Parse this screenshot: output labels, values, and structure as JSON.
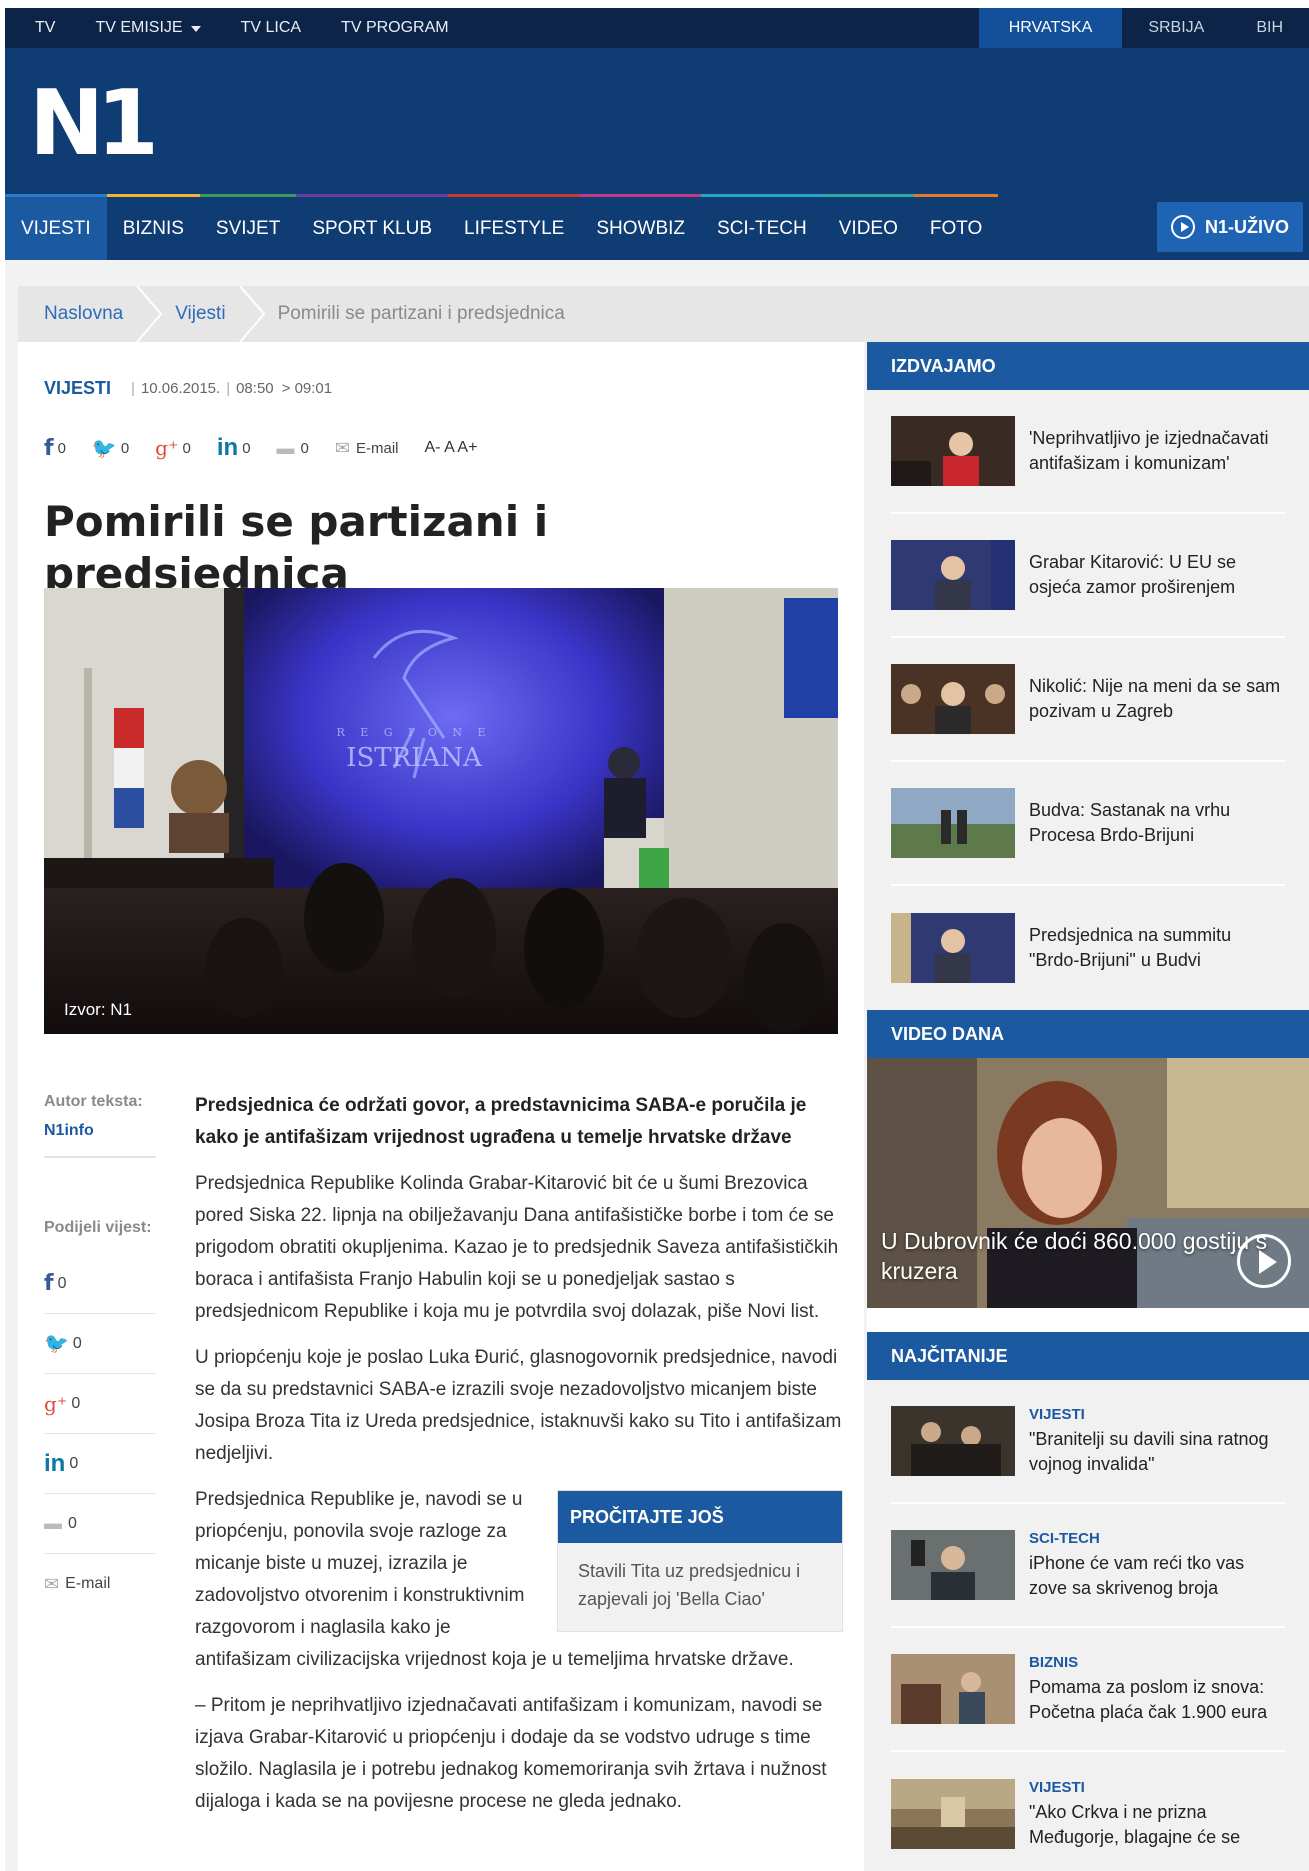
{
  "topbar": {
    "links": [
      "TV",
      "TV EMISIJE",
      "TV LICA",
      "TV PROGRAM"
    ],
    "regions": [
      "HRVATSKA",
      "SRBIJA",
      "BIH"
    ]
  },
  "logo": "N1",
  "nav": {
    "items": [
      "VIJESTI",
      "BIZNIS",
      "SVIJET",
      "SPORT KLUB",
      "LIFESTYLE",
      "SHOWBIZ",
      "SCI-TECH",
      "VIDEO",
      "FOTO"
    ],
    "live": "N1-UŽIVO"
  },
  "breadcrumb": [
    "Naslovna",
    "Vijesti",
    "Pomirili se partizani i predsjednica"
  ],
  "article": {
    "category": "VIJESTI",
    "date": "10.06.2015.",
    "time": "08:50",
    "updated": "> 09:01",
    "share_counts": {
      "facebook": "0",
      "twitter": "0",
      "gplus": "0",
      "linkedin": "0",
      "comments": "0"
    },
    "email_label": "E-mail",
    "font_controls": "A- A A+",
    "title": "Pomirili se partizani i predsjednica",
    "photo_caption": "Izvor: N1",
    "photo_signage": "R E G I O N E\nISTRIANA",
    "author_label": "Autor teksta:",
    "author": "N1info",
    "share_label": "Podijeli vijest:",
    "lead": "Predsjednica će održati govor, a predstavnicima SABA-e poručila je kako je antifašizam vrijednost ugrađena u temelje hrvatske države",
    "p1": "Predsjednica Republike Kolinda Grabar-Kitarović bit će u šumi Brezovica pored Siska 22. lipnja na obilježavanju Dana antifašističke borbe i tom će se prigodom obratiti okupljenima. Kazao je to predsjednik Saveza antifašističkih boraca i antifašista Franjo Habulin koji se u ponedjeljak sastao s predsjednicom Republike i koja mu je potvrdila svoj dolazak, piše Novi list.",
    "p2": "U priopćenju koje je poslao Luka Đurić, glasnogovornik predsjednice, navodi se da su predstavnici SABA-e izrazili svoje nezadovoljstvo micanjem biste Josipa Broza Tita iz Ureda predsjednice, istaknuvši kako su Tito i antifašizam nedjeljivi.",
    "p3": "Predsjednica Republike je, navodi se u priopćenju, ponovila svoje razloge za micanje biste u muzej, izrazila je zadovoljstvo otvorenim i konstruktivnim razgovorom i naglasila kako je antifašizam civilizacijska vrijednost koja je u temeljima hrvatske države.",
    "p4": "– Pritom je neprihvatljivo izjednačavati antifašizam i komunizam, navodi se izjava Grabar-Kitarović u priopćenju i dodaje da se vodstvo udruge s time složilo. Naglasila je i potrebu jednakog komemoriranja svih žrtava i nužnost dijaloga i kada se na povijesne procese ne gleda jednako.",
    "readmore_title": "PROČITAJTE JOŠ",
    "readmore_link": "Stavili Tita uz predsjednicu i zapjevali joj 'Bella Ciao'"
  },
  "sidebar": {
    "izdvajamo_title": "IZDVAJAMO",
    "izdvajamo": [
      "'Neprihvatljivo je izjednačavati antifašizam i komunizam'",
      "Grabar Kitarović: U EU se osjeća zamor proširenjem",
      "Nikolić: Nije na meni da se sam pozivam u Zagreb",
      "Budva: Sastanak na vrhu Procesa Brdo-Brijuni",
      "Predsjednica na summitu \"Brdo-Brijuni\" u Budvi"
    ],
    "video_title": "VIDEO DANA",
    "video_caption": "U Dubrovnik će doći 860.000 gostiju s kruzera",
    "najcitanije_title": "NAJČITANIJE",
    "najcitanije": [
      {
        "cat": "VIJESTI",
        "title": "\"Branitelji su davili sina ratnog vojnog invalida\""
      },
      {
        "cat": "SCI-TECH",
        "title": "iPhone će vam reći tko vas zove sa skrivenog broja"
      },
      {
        "cat": "BIZNIS",
        "title": "Pomama za poslom iz snova: Početna plaća čak 1.900 eura"
      },
      {
        "cat": "VIJESTI",
        "title": "\"Ako Crkva i ne prizna Međugorje, blagajne će se"
      }
    ]
  }
}
